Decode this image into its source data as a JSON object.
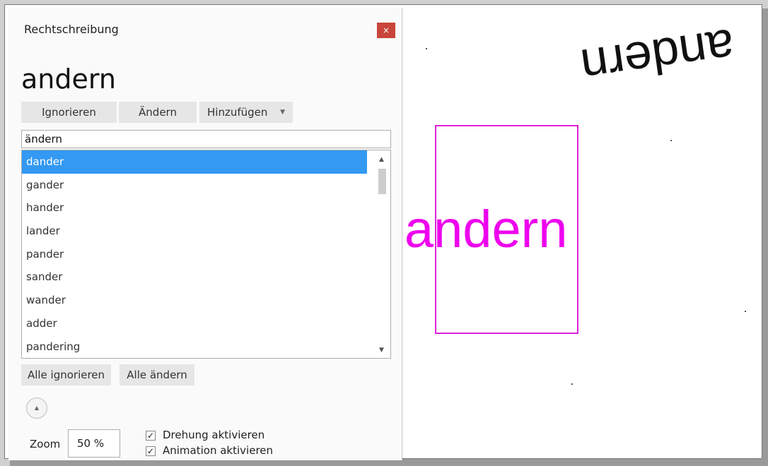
{
  "panel": {
    "title": "Rechtschreibung",
    "close_glyph": "×",
    "word": "andern",
    "buttons": {
      "ignore": "Ignorieren",
      "change": "Ändern",
      "add": "Hinzufügen",
      "add_caret": "▼",
      "ignore_all": "Alle ignorieren",
      "change_all": "Alle ändern"
    },
    "change_to": "ändern",
    "suggestions": [
      {
        "label": "dander",
        "selected": true
      },
      {
        "label": "gander"
      },
      {
        "label": "hander"
      },
      {
        "label": "lander"
      },
      {
        "label": "pander"
      },
      {
        "label": "sander"
      },
      {
        "label": "wander"
      },
      {
        "label": "adder"
      },
      {
        "label": "pandering"
      }
    ],
    "scroll": {
      "up": "▲",
      "down": "▼"
    },
    "expand_glyph": "▲",
    "zoom_label": "Zoom",
    "zoom_value": "50 %",
    "options": {
      "rotation": {
        "label": "Drehung aktivieren",
        "checked": true,
        "tick": "✓"
      },
      "animation": {
        "label": "Animation aktivieren",
        "checked": true,
        "tick": "✓"
      }
    }
  },
  "canvas": {
    "rotated_word": "andern",
    "highlight_word": "andern",
    "highlight_color": "#ee00ee",
    "selected_color": "#3399f2",
    "close_color": "#c9443a"
  }
}
